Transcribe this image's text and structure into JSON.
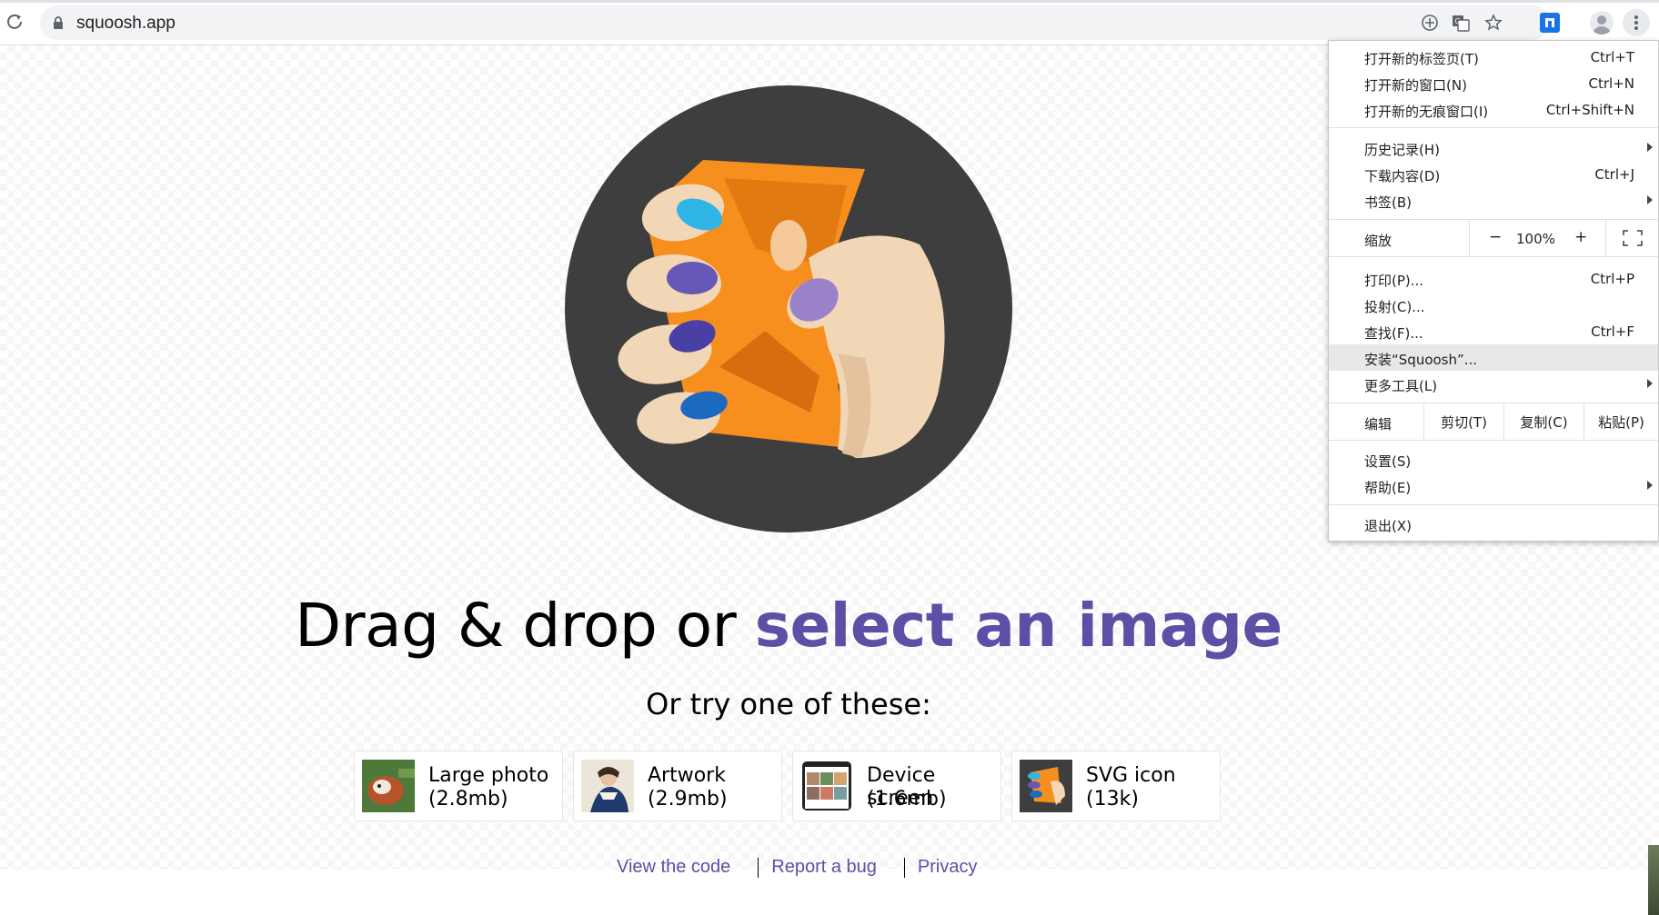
{
  "browser": {
    "url": "squoosh.app",
    "icons": [
      "reload-icon",
      "lock-icon",
      "add-icon",
      "translate-icon",
      "star-icon",
      "extension-icon",
      "profile-icon",
      "more-vert-icon"
    ]
  },
  "page": {
    "headline_prefix": "Drag & drop or ",
    "headline_link": "select an image",
    "subhead": "Or try one of these:",
    "demos": [
      {
        "title": "Large photo",
        "size": "(2.8mb)"
      },
      {
        "title": "Artwork",
        "size": "(2.9mb)"
      },
      {
        "title": "Device screen",
        "size": "(1.6mb)"
      },
      {
        "title": "SVG icon",
        "size": "(13k)"
      }
    ],
    "footer_links": [
      "View the code",
      "Report a bug",
      "Privacy"
    ],
    "colors": {
      "link": "#5f4ea5",
      "logo_bg": "#3e3e3e",
      "logo_orange": "#f78f1e"
    }
  },
  "menu": {
    "new_tab": {
      "label": "打开新的标签页(T)",
      "shortcut": "Ctrl+T"
    },
    "new_window": {
      "label": "打开新的窗口(N)",
      "shortcut": "Ctrl+N"
    },
    "incognito": {
      "label": "打开新的无痕窗口(I)",
      "shortcut": "Ctrl+Shift+N"
    },
    "history": {
      "label": "历史记录(H)"
    },
    "downloads": {
      "label": "下载内容(D)",
      "shortcut": "Ctrl+J"
    },
    "bookmarks": {
      "label": "书签(B)"
    },
    "zoom": {
      "label": "缩放",
      "minus": "−",
      "value": "100%",
      "plus": "+"
    },
    "print": {
      "label": "打印(P)...",
      "shortcut": "Ctrl+P"
    },
    "cast": {
      "label": "投射(C)..."
    },
    "find": {
      "label": "查找(F)...",
      "shortcut": "Ctrl+F"
    },
    "install": {
      "label": "安装“Squoosh”..."
    },
    "more_tools": {
      "label": "更多工具(L)"
    },
    "edit": {
      "label": "编辑",
      "cut": "剪切(T)",
      "copy": "复制(C)",
      "paste": "粘贴(P)"
    },
    "settings": {
      "label": "设置(S)"
    },
    "help": {
      "label": "帮助(E)"
    },
    "exit": {
      "label": "退出(X)"
    }
  }
}
